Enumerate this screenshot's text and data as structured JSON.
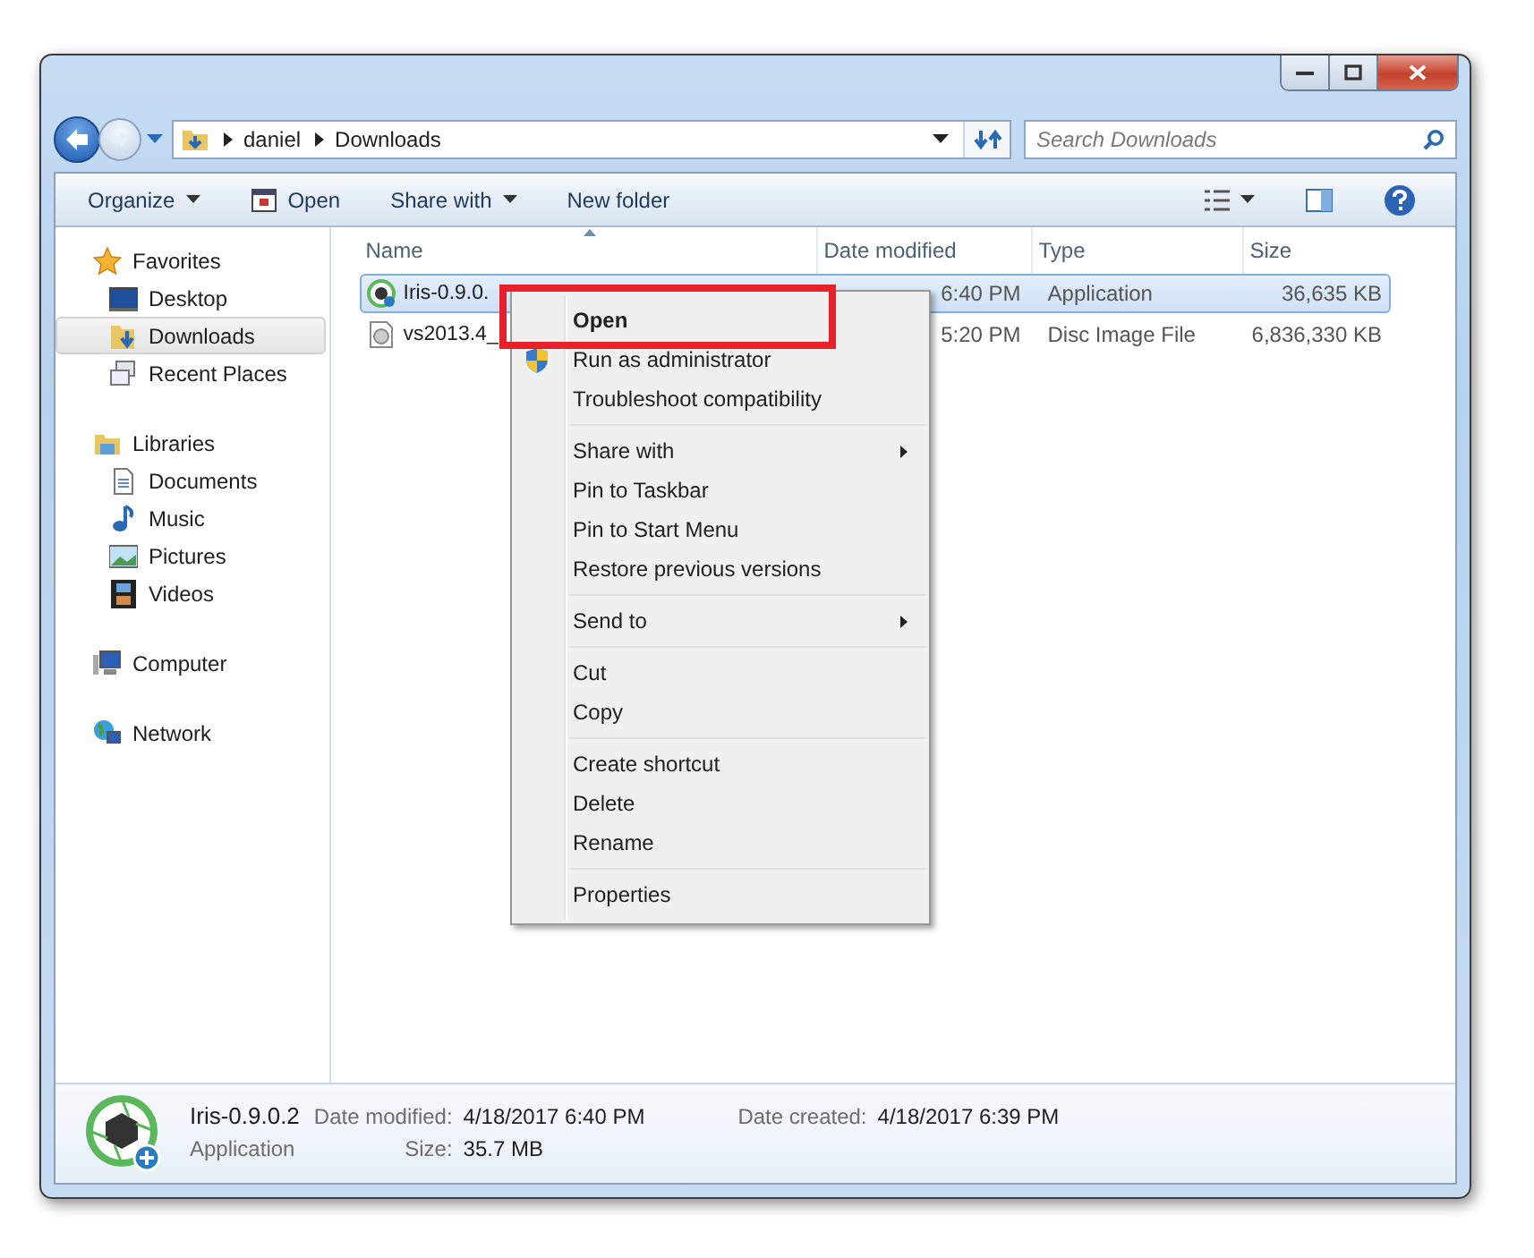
{
  "address": {
    "crumbs": [
      "daniel",
      "Downloads"
    ]
  },
  "search": {
    "placeholder": "Search Downloads"
  },
  "toolbar": [
    {
      "label": "Organize",
      "kind": "dropdown"
    },
    {
      "label": "Open",
      "kind": "icon"
    },
    {
      "label": "Share with",
      "kind": "dropdown"
    },
    {
      "label": "New folder",
      "kind": "plain"
    }
  ],
  "nav": [
    {
      "label": "Favorites",
      "kind": "star",
      "selected": false,
      "children": [
        {
          "label": "Desktop",
          "kind": "desktop",
          "selected": false
        },
        {
          "label": "Downloads",
          "kind": "downloads",
          "selected": true
        },
        {
          "label": "Recent Places",
          "kind": "recent",
          "selected": false
        }
      ]
    },
    {
      "label": "Libraries",
      "kind": "libraries",
      "selected": false,
      "children": [
        {
          "label": "Documents",
          "kind": "document",
          "selected": false
        },
        {
          "label": "Music",
          "kind": "music",
          "selected": false
        },
        {
          "label": "Pictures",
          "kind": "pictures",
          "selected": false
        },
        {
          "label": "Videos",
          "kind": "videos",
          "selected": false
        }
      ]
    },
    {
      "label": "Computer",
      "kind": "computer",
      "selected": false
    },
    {
      "label": "Network",
      "kind": "network",
      "selected": false
    }
  ],
  "table": {
    "columns": [
      {
        "label": "Name",
        "sorted": true
      },
      {
        "label": "Date modified",
        "sorted": false
      },
      {
        "label": "Type",
        "sorted": false
      },
      {
        "label": "Size",
        "sorted": false
      }
    ],
    "rows": [
      {
        "kind": "app",
        "name": "Iris-0.9.0.",
        "date": "6:40 PM",
        "type": "Application",
        "size": "36,635 KB",
        "selected": true
      },
      {
        "kind": "disc",
        "name": "vs2013.4_",
        "date": "5:20 PM",
        "type": "Disc Image File",
        "size": "6,836,330 KB",
        "selected": false
      }
    ]
  },
  "context_menu": [
    [
      {
        "label": "Open",
        "kind": "default",
        "highlighted": true
      },
      {
        "label": "Run as administrator",
        "kind": "shield",
        "highlighted": false
      },
      {
        "label": "Troubleshoot compatibility",
        "kind": "plain",
        "highlighted": false
      }
    ],
    [
      {
        "label": "Share with",
        "kind": "submenu",
        "highlighted": false
      },
      {
        "label": "Pin to Taskbar",
        "kind": "plain",
        "highlighted": false
      },
      {
        "label": "Pin to Start Menu",
        "kind": "plain",
        "highlighted": false
      },
      {
        "label": "Restore previous versions",
        "kind": "plain",
        "highlighted": false
      }
    ],
    [
      {
        "label": "Send to",
        "kind": "submenu",
        "highlighted": false
      }
    ],
    [
      {
        "label": "Cut",
        "kind": "plain",
        "highlighted": false
      },
      {
        "label": "Copy",
        "kind": "plain",
        "highlighted": false
      }
    ],
    [
      {
        "label": "Create shortcut",
        "kind": "plain",
        "highlighted": false
      },
      {
        "label": "Delete",
        "kind": "plain",
        "highlighted": false
      },
      {
        "label": "Rename",
        "kind": "plain",
        "highlighted": false
      }
    ],
    [
      {
        "label": "Properties",
        "kind": "plain",
        "highlighted": false
      }
    ]
  ],
  "details": {
    "name": "Iris-0.9.0.2",
    "type": "Application",
    "fields": [
      {
        "label": "Date modified:",
        "value": "4/18/2017 6:40 PM"
      },
      {
        "label": "Date created:",
        "value": "4/18/2017 6:39 PM"
      },
      {
        "label": "Size:",
        "value": "35.7 MB"
      }
    ]
  }
}
